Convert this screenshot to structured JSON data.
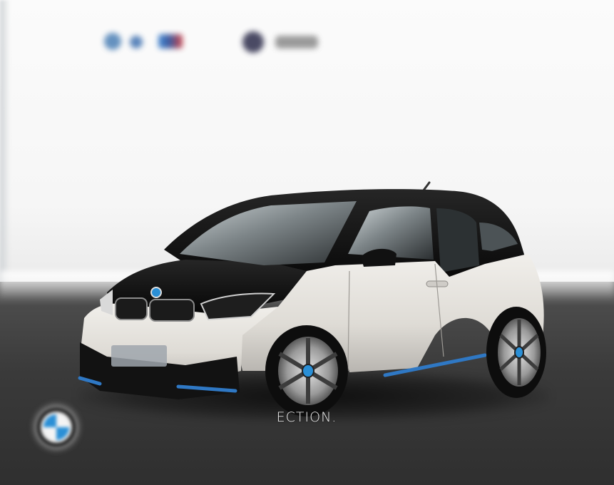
{
  "scene": {
    "caption": "ECTION.",
    "brand_mark": "bmw-roundel-icon",
    "background_logos": [
      "bmw-logo-icon",
      "bmw-i-logo-icon",
      "bmw-m-logo-icon",
      "bmw-roundel-icon",
      "bmw-text-logo-icon"
    ],
    "subject": "car",
    "colors": {
      "body": "#e8e5e0",
      "roof": "#111111",
      "accent": "#2f78c4",
      "floor": "#363636",
      "wall": "#f7f7f7"
    }
  }
}
